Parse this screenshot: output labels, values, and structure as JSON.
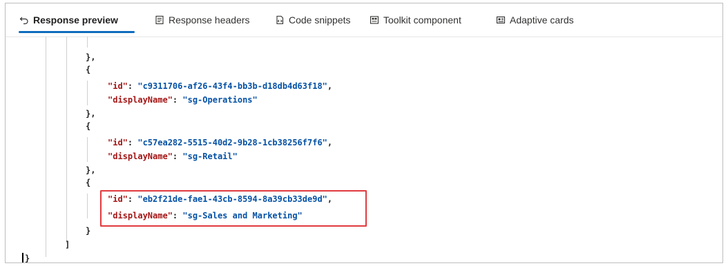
{
  "tabs": [
    {
      "label": "Response preview",
      "icon": "undo-arrow-icon",
      "active": true
    },
    {
      "label": "Response headers",
      "icon": "document-headers-icon",
      "active": false
    },
    {
      "label": "Code snippets",
      "icon": "code-snippet-icon",
      "active": false
    },
    {
      "label": "Toolkit component",
      "icon": "toolkit-component-icon",
      "active": false
    },
    {
      "label": "Adaptive cards",
      "icon": "adaptive-card-icon",
      "active": false
    }
  ],
  "code": {
    "line_open_brace_1": "{",
    "line_close_brace_prev": "},",
    "entries": [
      {
        "id_key": "\"id\"",
        "id_value": "\"c9311706-af26-43f4-bb3b-d18db4d63f18\"",
        "name_key": "\"displayName\"",
        "name_value": "\"sg-Operations\""
      },
      {
        "id_key": "\"id\"",
        "id_value": "\"c57ea282-5515-40d2-9b28-1cb38256f7f6\"",
        "name_key": "\"displayName\"",
        "name_value": "\"sg-Retail\""
      },
      {
        "id_key": "\"id\"",
        "id_value": "\"eb2f21de-fae1-43cb-8594-8a39cb33de9d\"",
        "name_key": "\"displayName\"",
        "name_value": "\"sg-Sales and Marketing\""
      }
    ],
    "array_close": "]",
    "object_close": "}"
  },
  "colors": {
    "accent": "#0f6cbd",
    "json_key": "#a31515",
    "json_string": "#0451a5",
    "highlight_border": "#e03a3e"
  }
}
